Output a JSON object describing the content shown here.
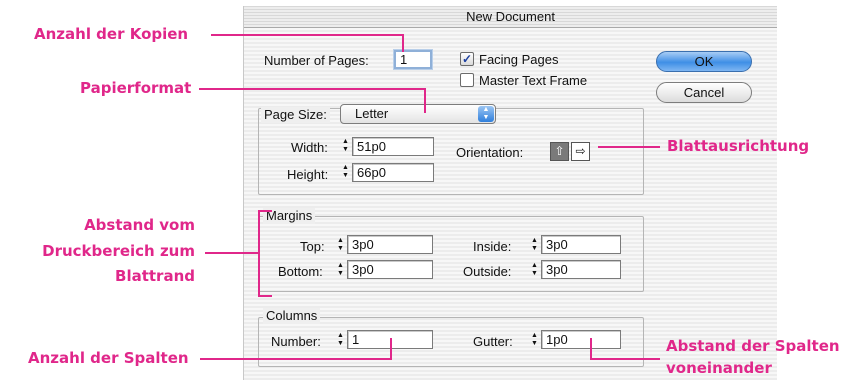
{
  "dialog": {
    "title": "New Document",
    "number_of_pages_label": "Number of Pages:",
    "number_of_pages_value": "1",
    "facing_pages_label": "Facing Pages",
    "facing_pages_checked": true,
    "master_text_frame_label": "Master Text Frame",
    "master_text_frame_checked": false,
    "ok_label": "OK",
    "cancel_label": "Cancel",
    "page_size": {
      "label": "Page Size:",
      "selected": "Letter",
      "width_label": "Width:",
      "width_value": "51p0",
      "height_label": "Height:",
      "height_value": "66p0",
      "orientation_label": "Orientation:",
      "orientation_selected": "portrait"
    },
    "margins": {
      "title": "Margins",
      "top_label": "Top:",
      "top_value": "3p0",
      "bottom_label": "Bottom:",
      "bottom_value": "3p0",
      "inside_label": "Inside:",
      "inside_value": "3p0",
      "outside_label": "Outside:",
      "outside_value": "3p0"
    },
    "columns": {
      "title": "Columns",
      "number_label": "Number:",
      "number_value": "1",
      "gutter_label": "Gutter:",
      "gutter_value": "1p0"
    }
  },
  "annotations": {
    "copies": "Anzahl der Kopien",
    "paper_format": "Papierformat",
    "margins_line1": "Abstand vom",
    "margins_line2": "Druckbereich zum",
    "margins_line3": "Blattrand",
    "columns_count": "Anzahl der Spalten",
    "orientation": "Blattausrichtung",
    "gutter_line1": "Abstand der Spalten",
    "gutter_line2": "voneinander"
  },
  "colors": {
    "annotation": "#e0278a",
    "default_button": "#3f8fe6"
  }
}
